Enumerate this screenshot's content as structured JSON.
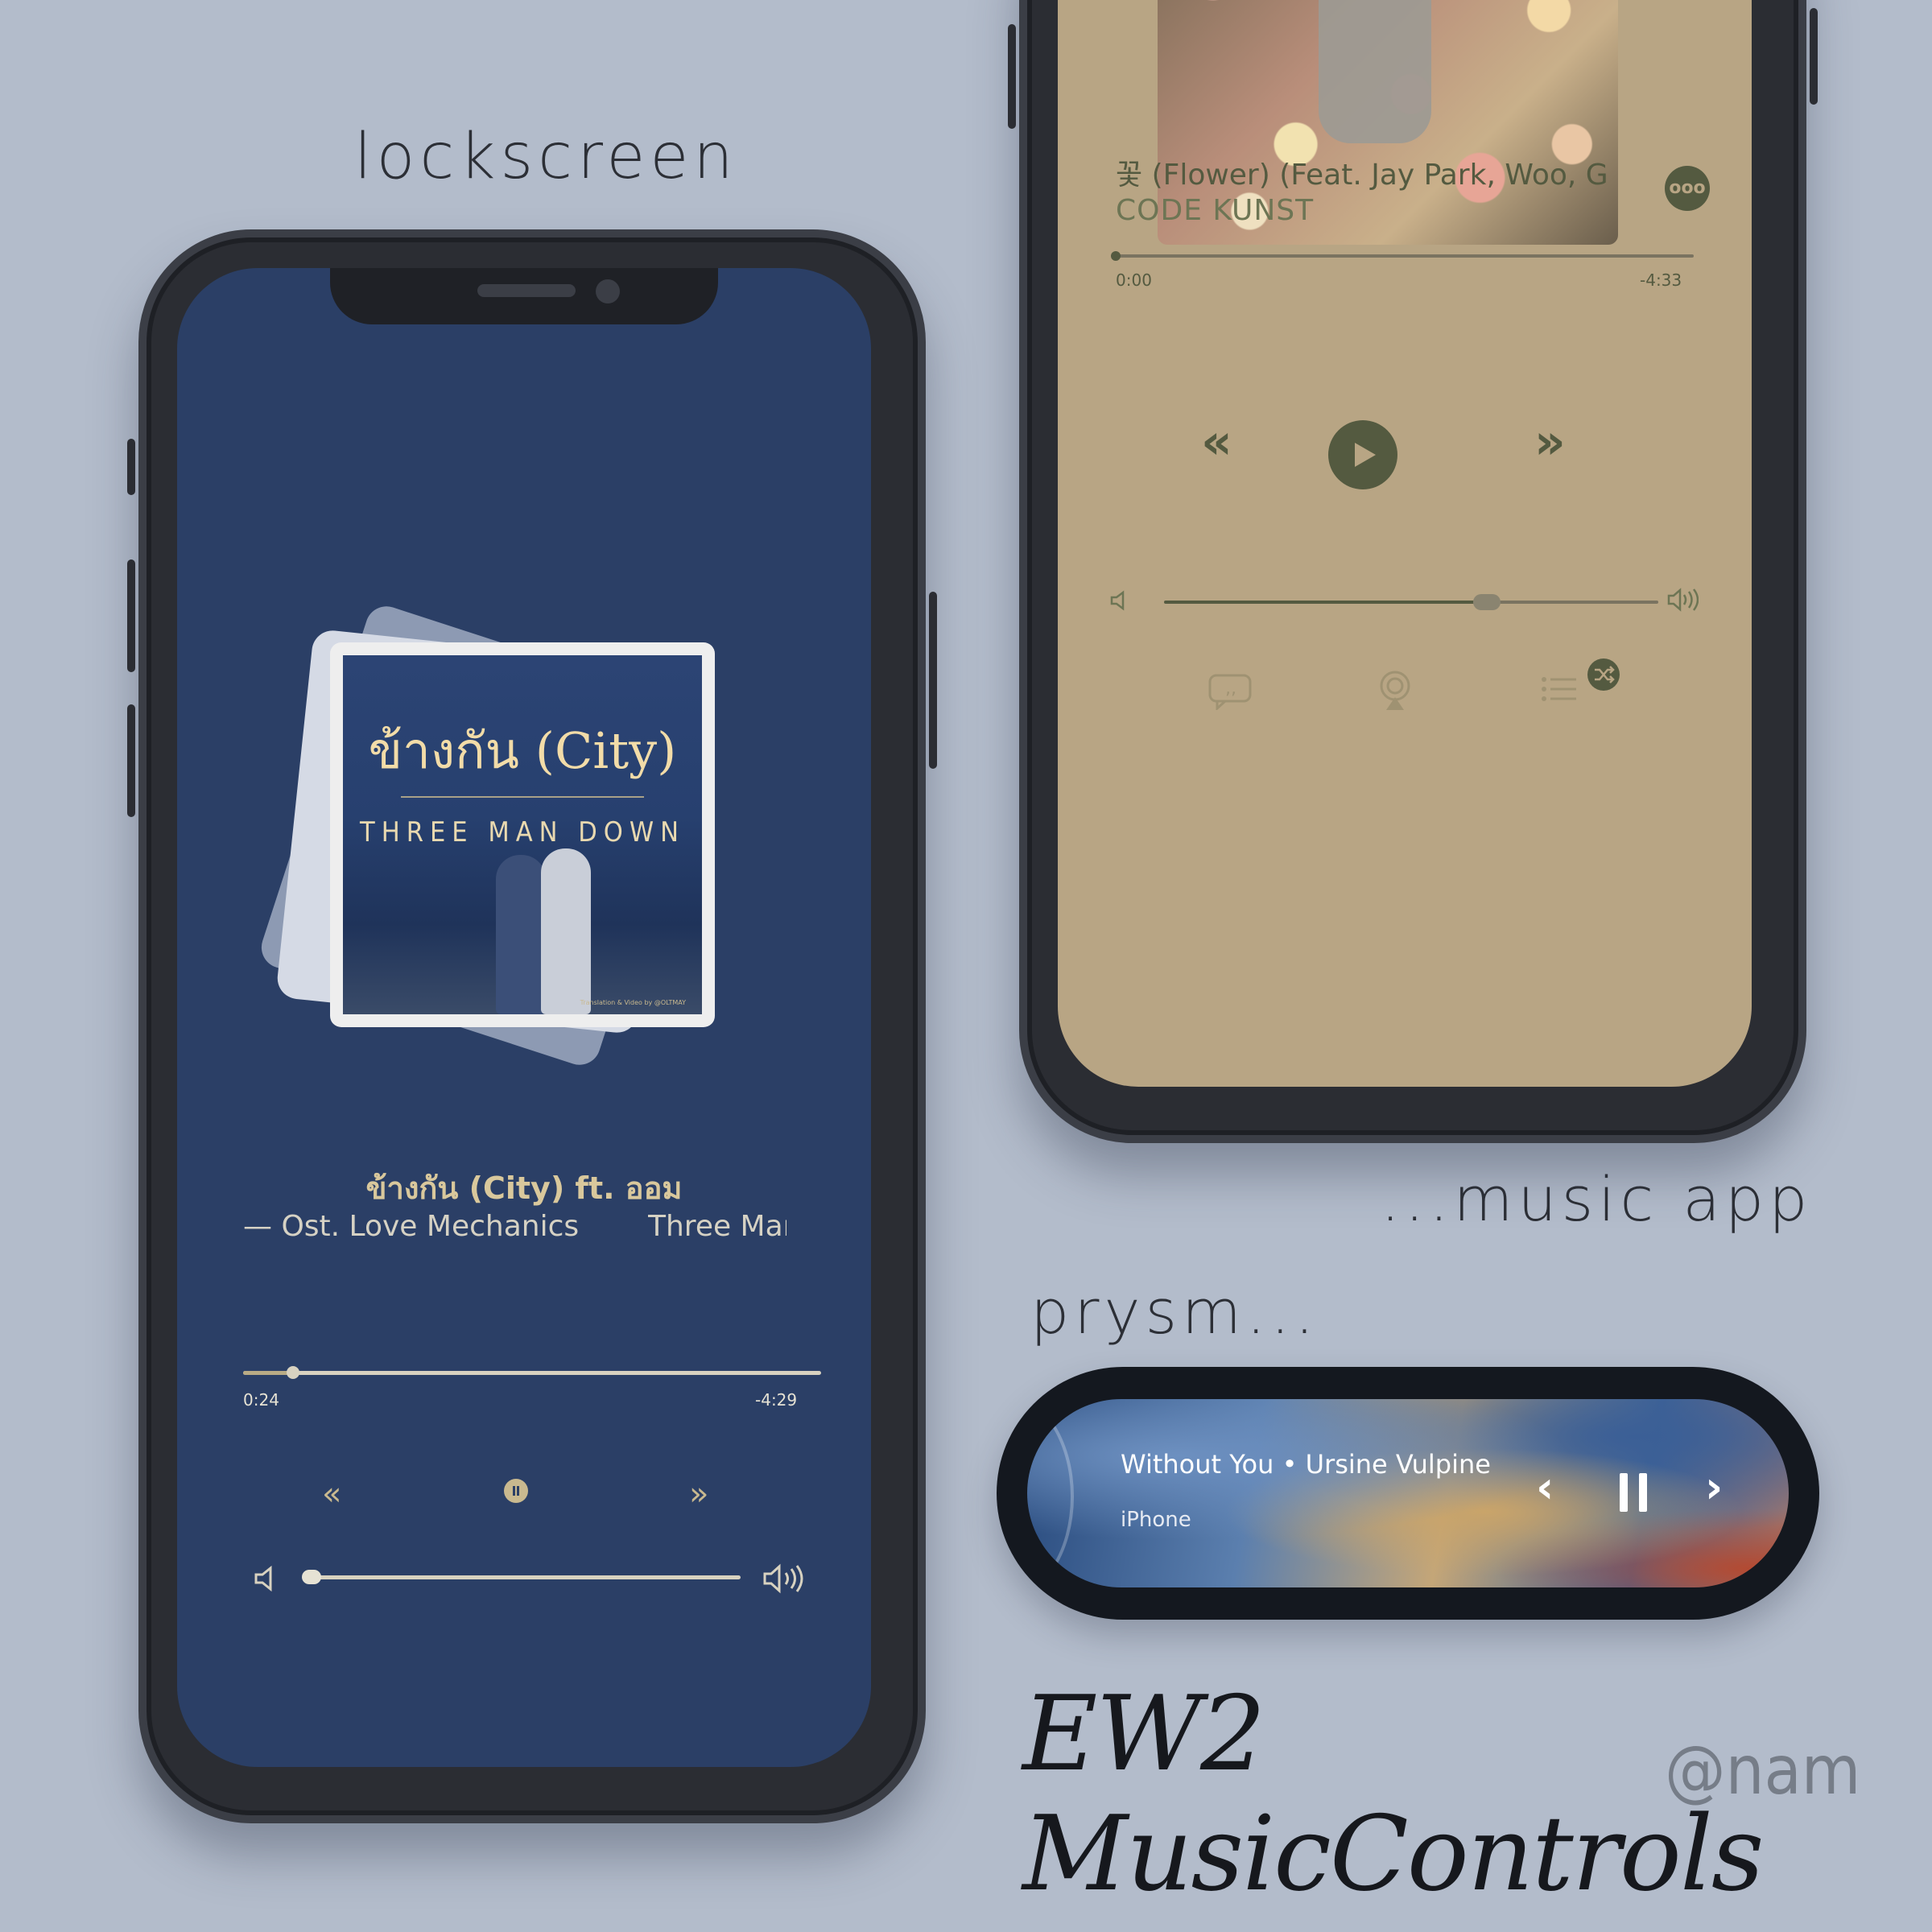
{
  "labels": {
    "lockscreen": "lockscreen",
    "music_app": "...music app",
    "prysm": "prysm..."
  },
  "lockscreen": {
    "artwork": {
      "title": "ข้างกัน (City)",
      "band": "THREE MAN DOWN",
      "credit": "Translation & Video by @OLTMAY"
    },
    "track_title": "ข้างกัน (City) ft. ออม",
    "subtitle": "— Ost. Love Mechanics",
    "artist": "Three Man",
    "progress": {
      "elapsed": "0:24",
      "remaining": "-4:29",
      "fraction": 0.08
    },
    "volume": {
      "fraction": 0.02
    },
    "icons": [
      "chevron-left-icon",
      "pause-icon",
      "chevron-right-icon",
      "volume-low-icon",
      "volume-high-icon"
    ]
  },
  "music_app": {
    "track_title": "꽃 (Flower) (Feat. Jay Park, Woo, G",
    "artist": "CODE KUNST",
    "more_label": "ooo",
    "progress": {
      "elapsed": "0:00",
      "remaining": "-4:33",
      "fraction": 0.0
    },
    "volume": {
      "fraction": 0.64
    },
    "colors": {
      "background": "#b8a584",
      "accent": "#545a40"
    },
    "icons": [
      "chevron-left-icon",
      "play-icon",
      "chevron-right-icon",
      "volume-low-icon",
      "volume-high-icon",
      "lyrics-icon",
      "airplay-icon",
      "queue-icon",
      "shuffle-icon"
    ]
  },
  "prysm": {
    "now_playing": "Without You • Ursine Vulpine",
    "device": "iPhone",
    "icons": [
      "chevron-left-icon",
      "pause-icon",
      "chevron-right-icon"
    ]
  },
  "branding": {
    "title": "EW2 MusicControls",
    "handle": "@nam"
  }
}
